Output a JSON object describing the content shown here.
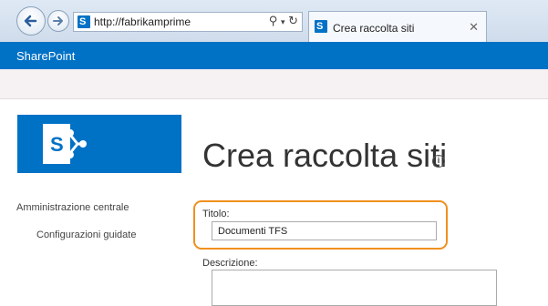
{
  "browser": {
    "url": "http://fabrikamprime",
    "tab_title": "Crea raccolta siti"
  },
  "suite_bar": {
    "title": "SharePoint"
  },
  "page": {
    "title": "Crea raccolta siti"
  },
  "left_nav": {
    "items": [
      {
        "label": "Amministrazione centrale"
      },
      {
        "label": "Configurazioni guidate"
      }
    ]
  },
  "form": {
    "title_label": "Titolo:",
    "title_value": "Documenti TFS",
    "description_label": "Descrizione:"
  },
  "colors": {
    "brand_blue": "#0072c6",
    "highlight_orange": "#f0901e"
  },
  "icons": [
    "back-icon",
    "forward-icon",
    "search-icon",
    "dropdown-icon",
    "refresh-icon",
    "close-icon",
    "info-icon",
    "sharepoint-logo-icon"
  ]
}
